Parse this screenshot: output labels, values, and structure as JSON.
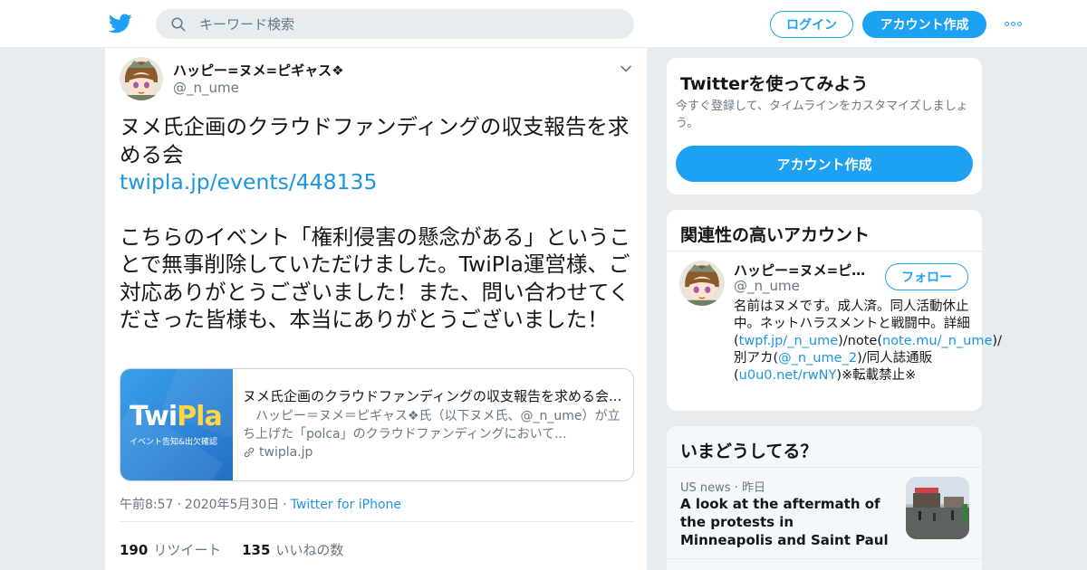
{
  "header": {
    "search_placeholder": "キーワード検索",
    "login_label": "ログイン",
    "signup_label": "アカウント作成"
  },
  "tweet": {
    "author_name": "ハッピー=ヌメ=ピギャス❖",
    "author_handle": "@_n_ume",
    "text_line1": "ヌメ氏企画のクラウドファンディングの収支報告を求める会",
    "link": "twipla.jp/events/448135",
    "text_body": "こちらのイベント「権利侵害の懸念がある」ということで無事削除していただけました。TwiPla運営様、ご対応ありがとうございました！また、問い合わせてくださった皆様も、本当にありがとうございました！",
    "card": {
      "logo_twi": "Twi",
      "logo_pla": "Pla",
      "logo_sub": "イベント告知&出欠確認",
      "title": "ヌメ氏企画のクラウドファンディングの収支報告を求める会...",
      "description": "　ハッピー＝ヌメ＝ピギャス❖氏（以下ヌメ氏、@_n_ume）が立ち上げた「polca」のクラウドファンディングにおいて...",
      "domain": "twipla.jp"
    },
    "time": "午前8:57",
    "date": "2020年5月30日",
    "client": "Twitter for iPhone",
    "retweet_count": "190",
    "retweet_label": "リツイート",
    "like_count": "135",
    "like_label": "いいねの数"
  },
  "signup_module": {
    "title": "Twitterを使ってみよう",
    "description": "今すぐ登録して、タイムラインをカスタマイズしましょう。",
    "button": "アカウント作成"
  },
  "related_module": {
    "title": "関連性の高いアカウント",
    "name": "ハッピー=ヌメ=ピギャス❖",
    "handle": "@_n_ume",
    "follow": "フォロー",
    "bio_1": "名前はヌメです。成人済。同人活動休止中。ネットハラスメントと戦闘中。詳細(",
    "bio_link1": "twpf.jp/_n_ume",
    "bio_2": ")/note(",
    "bio_link2": "note.mu/_n_ume",
    "bio_3": ")/別アカ(",
    "bio_link3": "@_n_ume_2",
    "bio_4": ")/同人誌通販(",
    "bio_link4": "u0u0.net/rwNY",
    "bio_5": ")※転載禁止※"
  },
  "trends_module": {
    "title": "いまどうしてる？",
    "meta_source": "US news",
    "meta_time": "昨日",
    "headline": "A look at the aftermath of the protests in Minneapolis and Saint Paul"
  }
}
